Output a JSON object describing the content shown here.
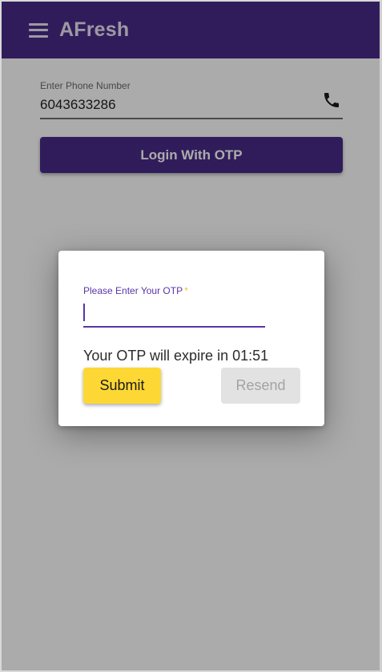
{
  "app": {
    "title": "AFresh",
    "accent": "#4a2a88"
  },
  "icons": {
    "menu": "menu-icon",
    "phone": "phone-icon"
  },
  "login": {
    "phone_label": "Enter Phone Number",
    "phone_value": "6043633286",
    "login_button": "Login With OTP"
  },
  "otp_dialog": {
    "label": "Please Enter Your OTP",
    "required_marker": "*",
    "input_value": "",
    "expire_text": "Your OTP will expire in 01:51",
    "submit_label": "Submit",
    "resend_label": "Resend",
    "submit_color": "#fdd835"
  }
}
